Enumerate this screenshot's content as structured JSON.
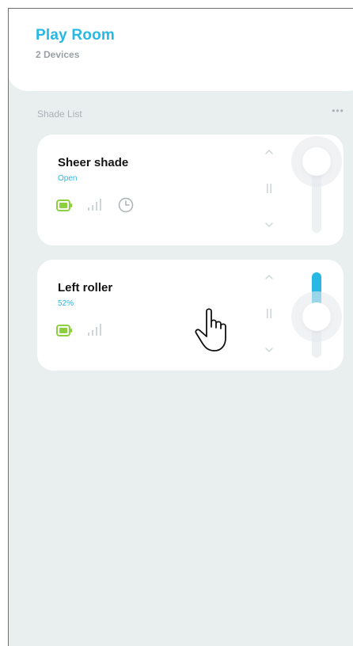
{
  "header": {
    "room_name": "Play Room",
    "device_count": "2 Devices"
  },
  "section": {
    "label": "Shade List",
    "more_icon": "ellipsis-icon",
    "more_glyph": "•••"
  },
  "shades": [
    {
      "name": "Sheer shade",
      "status": "Open",
      "icons": [
        "battery-icon",
        "signal-icon",
        "clock-icon"
      ],
      "position_percent": 0
    },
    {
      "name": "Left roller",
      "status": "52%",
      "icons": [
        "battery-icon",
        "signal-icon"
      ],
      "position_percent": 52
    }
  ],
  "controls": {
    "up_icon": "chevron-up-icon",
    "pause_icon": "pause-icon",
    "down_icon": "chevron-down-icon"
  },
  "colors": {
    "accent": "#29b8e3",
    "battery": "#8ccf3f",
    "background": "#e9eeef",
    "card": "#ffffff"
  },
  "overlay": {
    "cursor_icon": "hand-pointer-icon"
  }
}
